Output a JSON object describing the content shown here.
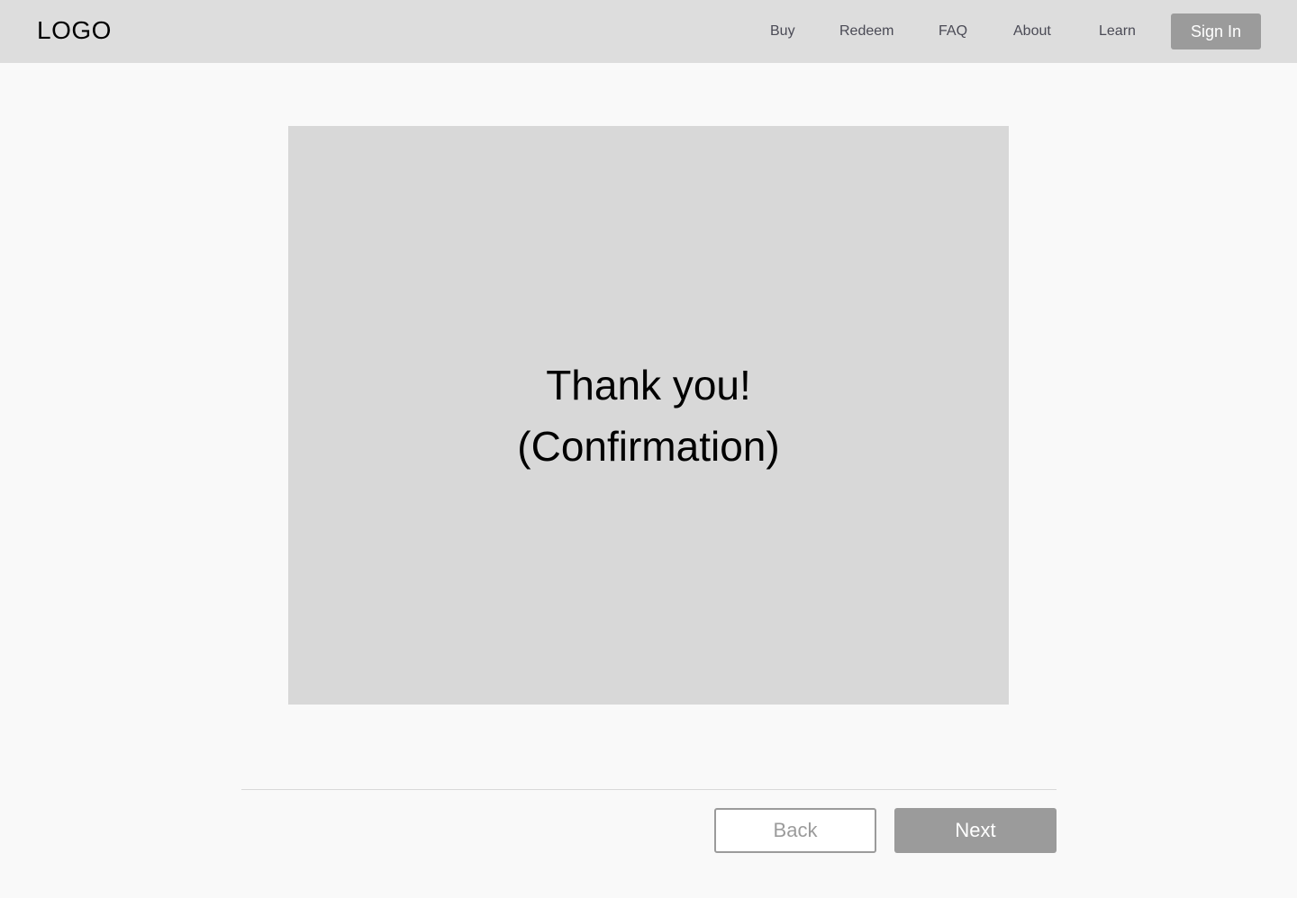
{
  "header": {
    "logo": "LOGO",
    "nav": {
      "buy": "Buy",
      "redeem": "Redeem",
      "faq": "FAQ",
      "about": "About",
      "learn": "Learn"
    },
    "sign_in_label": "Sign In"
  },
  "main": {
    "confirmation": {
      "line1": "Thank you!",
      "line2": "(Confirmation)"
    }
  },
  "footer": {
    "back_label": "Back",
    "next_label": "Next"
  },
  "colors": {
    "header_bg": "#dddddd",
    "page_bg": "#f9f9f9",
    "card_bg": "#d8d8d8",
    "button_gray": "#9b9b9b",
    "nav_text": "#4a4a55"
  }
}
